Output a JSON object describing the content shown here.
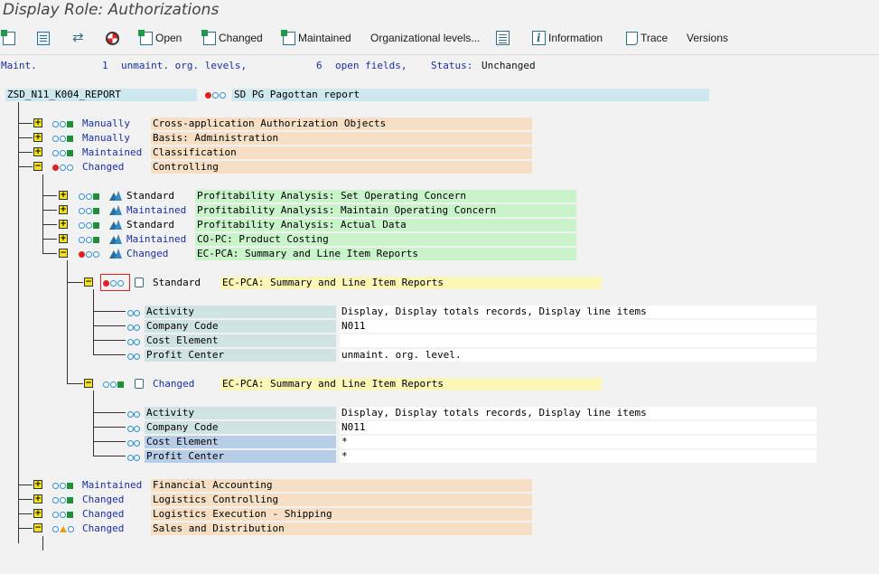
{
  "title": "Display Role: Authorizations",
  "toolbar": {
    "open": "Open",
    "changed": "Changed",
    "maintained": "Maintained",
    "org_levels": "Organizational levels...",
    "information": "Information",
    "trace": "Trace",
    "versions": "Versions"
  },
  "status": {
    "maint_label": "Maint.",
    "unmaint_count": "1",
    "unmaint_label": "unmaint. org. levels,",
    "open_count": "6",
    "open_label": "open fields,",
    "status_label": "Status:",
    "status_value": "Unchanged"
  },
  "role": {
    "name": "ZSD_N11_K004_REPORT",
    "description": "SD PG Pagottan report"
  },
  "level1": [
    {
      "status": "Manually",
      "text": "Cross-application Authorization Objects",
      "expanded": false,
      "lights": "green"
    },
    {
      "status": "Manually",
      "text": "Basis: Administration",
      "expanded": false,
      "lights": "green"
    },
    {
      "status": "Maintained",
      "text": "Classification",
      "expanded": false,
      "lights": "green"
    },
    {
      "status": "Changed",
      "text": "Controlling",
      "expanded": true,
      "lights": "red"
    }
  ],
  "controlling_objects": [
    {
      "status": "Standard",
      "text": "Profitability Analysis: Set Operating Concern",
      "expanded": false,
      "lights": "green"
    },
    {
      "status": "Maintained",
      "text": "Profitability Analysis: Maintain Operating Concern",
      "expanded": false,
      "lights": "green"
    },
    {
      "status": "Standard",
      "text": "Profitability Analysis: Actual Data",
      "expanded": false,
      "lights": "green"
    },
    {
      "status": "Maintained",
      "text": "CO-PC: Product Costing",
      "expanded": false,
      "lights": "green"
    },
    {
      "status": "Changed",
      "text": "EC-PCA: Summary and Line Item Reports",
      "expanded": true,
      "lights": "red"
    }
  ],
  "authorizations": [
    {
      "status": "Standard",
      "text": "EC-PCA: Summary and Line Item Reports",
      "lights": "red",
      "fields": [
        {
          "name": "Activity",
          "value": "Display, Display totals records, Display line items"
        },
        {
          "name": "Company Code",
          "value": "N011"
        },
        {
          "name": "Cost Element",
          "value": ""
        },
        {
          "name": "Profit Center",
          "value": "unmaint. org. level."
        }
      ]
    },
    {
      "status": "Changed",
      "text": "EC-PCA: Summary and Line Item Reports",
      "lights": "green",
      "fields": [
        {
          "name": "Activity",
          "value": "Display, Display totals records, Display line items"
        },
        {
          "name": "Company Code",
          "value": "N011"
        },
        {
          "name": "Cost Element",
          "value": "*"
        },
        {
          "name": "Profit Center",
          "value": "*"
        }
      ]
    }
  ],
  "level1_bottom": [
    {
      "status": "Maintained",
      "text": "Financial Accounting",
      "expanded": false,
      "lights": "green"
    },
    {
      "status": "Changed",
      "text": "Logistics Controlling",
      "expanded": false,
      "lights": "green"
    },
    {
      "status": "Changed",
      "text": "Logistics Execution - Shipping",
      "expanded": false,
      "lights": "green"
    },
    {
      "status": "Changed",
      "text": "Sales and Distribution",
      "expanded": true,
      "lights": "yellow"
    }
  ],
  "colors": {
    "status_blue": "#1a2ea0",
    "orange_row": "#f6dfc4",
    "green_row": "#c9f3c9",
    "yellow_row": "#fbf7b8",
    "role_bg": "#cde8ef"
  }
}
